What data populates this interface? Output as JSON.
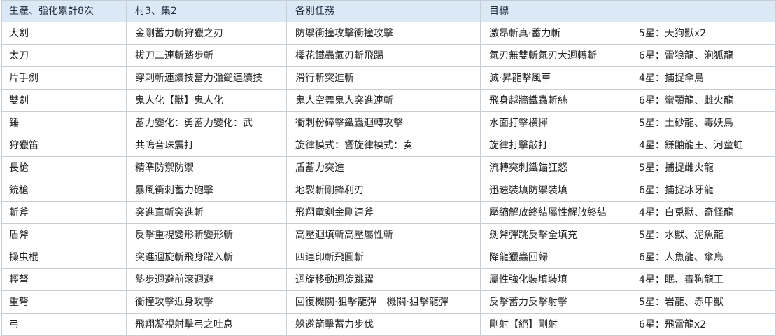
{
  "table": {
    "headers": [
      "生產、強化累計8次",
      "村3、集2",
      "各別任務",
      "目標",
      ""
    ],
    "rows": [
      [
        "大劍",
        "金剛蓄力斬狩獵之刃",
        "防禦衝撞攻擊衝撞攻擊",
        "激昂斬真·蓄力斬",
        "5星：天狗獸x2"
      ],
      [
        "太刀",
        "拔刀二連斬踏步斬",
        "櫻花鐵蟲氣刃斬飛踢",
        "氣刃無雙斬氣刃大迴轉斬",
        "6星：雷狼龍、泡狐龍"
      ],
      [
        "片手劍",
        "穿刺斬連續技奮力強鎚連續技",
        "滑行斬突進斬",
        "滅·昇龍擊風車",
        "4星：捕捉傘鳥"
      ],
      [
        "雙劍",
        "鬼人化【獸】鬼人化",
        "鬼人空舞鬼人突進連斬",
        "飛身越牆鐵蟲斬絲",
        "6星：蠻顎龍、雌火龍"
      ],
      [
        "錘",
        "蓄力變化：勇蓄力變化：武",
        "衝刺粉碎擊鐵蟲迴轉攻擊",
        "水面打擊橫揮",
        "5星：土砂龍、毒妖鳥"
      ],
      [
        "狩獵笛",
        "共鳴音珠震打",
        "旋律模式：響旋律模式：奏",
        "旋律打擊敲打",
        "4星：鎌鼬龍王、河童蛙"
      ],
      [
        "長槍",
        "精準防禦防禦",
        "盾蓄力突進",
        "流轉突刺鐵錨狂怒",
        "5星：捕捉雌火龍"
      ],
      [
        "銃槍",
        "暴風衝刺蓄力砲擊",
        "地裂斬剛鋒利刃",
        "迅速裝填防禦裝填",
        "6星：捕捉冰牙龍"
      ],
      [
        "斬斧",
        "突進直斬突進斬",
        "飛翔竜剣金剛連斧",
        "壓縮解放終結屬性解放終結",
        "4星：白兎獸、奇怪龍"
      ],
      [
        "盾斧",
        "反擊重視變形斬變形斬",
        "高壓迴填斬高壓屬性斬",
        "劍斧彈跳反擊全填充",
        "5星：水獸、泥魚龍"
      ],
      [
        "操虫棍",
        "突進迴旋斬飛身躍入斬",
        "四連印斬飛圓斬",
        "降龍獵蟲回歸",
        "6星：人魚龍、傘鳥"
      ],
      [
        "輕弩",
        "墊步迴避前滾迴避",
        "迴旋移動迴旋跳躍",
        "屬性強化裝填裝填",
        "4星：眠、毒狗龍王"
      ],
      [
        "重弩",
        "衝撞攻擊近身攻擊",
        "回復機關·狙擊龍彈　機關·狙擊龍彈",
        "反擊蓄力反擊射擊",
        "5星：岩龍、赤甲獸"
      ],
      [
        "弓",
        "飛翔凝視射擊弓之吐息",
        "躲避箭擊蓄力步伐",
        "剛射【絕】剛射",
        "6星：飛雷龍x2"
      ]
    ]
  }
}
